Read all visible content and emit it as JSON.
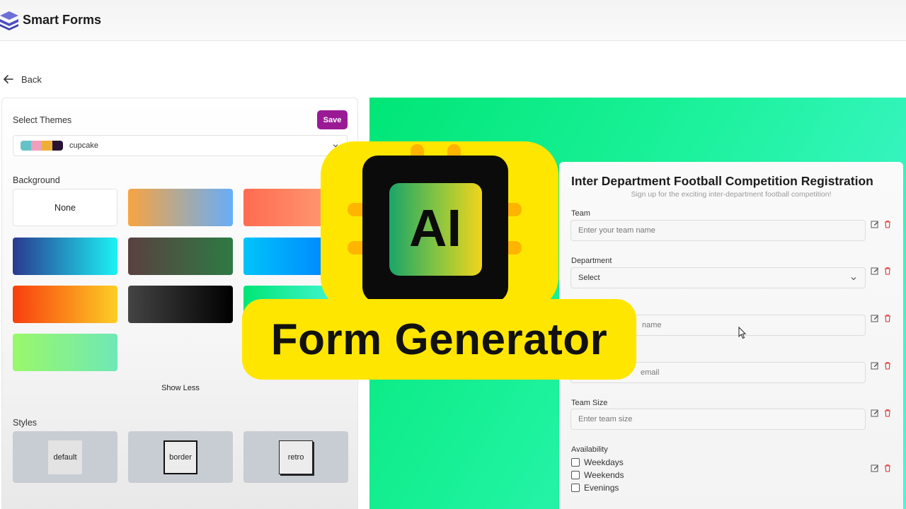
{
  "app": {
    "title": "Smart Forms",
    "logo_icon": "stacked-layers-logo"
  },
  "nav": {
    "back_label": "Back"
  },
  "theme_panel": {
    "select_themes_label": "Select Themes",
    "save_label": "Save",
    "save_color": "#9a1a95",
    "selected_theme": "cupcake",
    "theme_swatches": [
      "#65c3c8",
      "#ef9fbc",
      "#eeaf3a",
      "#291334"
    ],
    "background_label": "Background",
    "backgrounds": [
      {
        "label": "None"
      },
      {
        "colors": [
          "#f7a440",
          "#66aef9"
        ]
      },
      {
        "colors": [
          "#ff6b50",
          "#ffa37a"
        ]
      },
      {
        "colors": [
          "#2a3990",
          "#1bf2f5"
        ]
      },
      {
        "colors": [
          "#5a4040",
          "#2e7a44"
        ]
      },
      {
        "colors": [
          "#00c4fa",
          "#0078ff"
        ]
      },
      {
        "colors": [
          "#f83e0f",
          "#fcce25"
        ]
      },
      {
        "colors": [
          "#444444",
          "#000000"
        ]
      },
      {
        "colors": [
          "#00e676",
          "#4cf7dc"
        ]
      },
      {
        "colors": [
          "#9af86a",
          "#6ee8b5"
        ]
      }
    ],
    "show_less_label": "Show Less",
    "styles_label": "Styles",
    "styles": [
      "default",
      "border",
      "retro"
    ]
  },
  "form": {
    "title": "Inter Department Football Competition Registration",
    "subtitle": "Sign up for the exciting inter-department football competition!",
    "fields": {
      "team": {
        "label": "Team",
        "placeholder": "Enter your team name"
      },
      "department": {
        "label": "Department",
        "value": "Select"
      },
      "captain": {
        "placeholder": "name"
      },
      "email": {
        "placeholder": "email"
      },
      "team_size": {
        "label": "Team Size",
        "placeholder": "Enter team size"
      },
      "availability": {
        "label": "Availability",
        "options": [
          "Weekdays",
          "Weekends",
          "Evenings"
        ]
      }
    }
  },
  "overlay": {
    "ai_text": "AI",
    "caption": "Form Generator",
    "badge_color": "#ffe600"
  }
}
